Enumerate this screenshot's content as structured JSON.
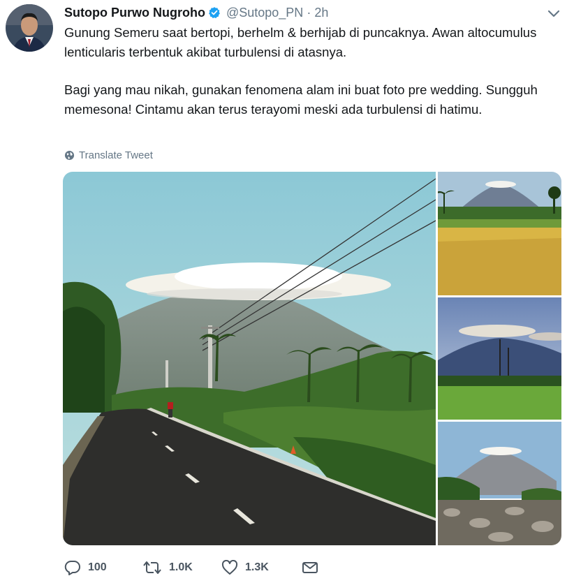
{
  "tweet": {
    "author_name": "Sutopo Purwo Nugroho",
    "handle": "@Sutopo_PN",
    "separator": "·",
    "time": "2h",
    "paragraph1": "Gunung Semeru saat bertopi, berhelm & berhijab di puncaknya. Awan altocumulus lenticularis terbentuk akibat turbulensi di atasnya.",
    "paragraph2": "Bagi yang mau nikah, gunakan fenomena alam ini buat foto pre wedding. Sungguh memesona! Cintamu akan terus terayomi meski ada turbulensi di hatimu.",
    "translate_label": "Translate Tweet"
  },
  "icons": {
    "verified": "verified-badge-icon",
    "caret": "chevron-down-icon",
    "translate": "globe-icon",
    "reply": "reply-icon",
    "retweet": "retweet-icon",
    "like": "heart-icon",
    "message": "envelope-icon"
  },
  "actions": {
    "reply_count": "100",
    "retweet_count": "1.0K",
    "like_count": "1.3K"
  },
  "colors": {
    "verified": "#1da1f2",
    "secondary_text": "#657786"
  }
}
